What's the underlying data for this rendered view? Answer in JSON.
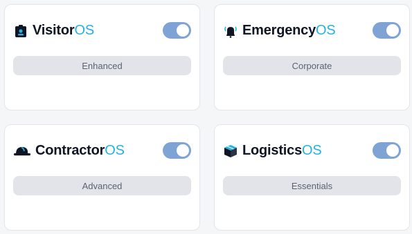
{
  "products": [
    {
      "name": "Visitor",
      "suffix": "OS",
      "icon": "visitor-badge-icon",
      "enabled": true,
      "tier": "Enhanced"
    },
    {
      "name": "Emergency",
      "suffix": "OS",
      "icon": "alarm-bell-icon",
      "enabled": true,
      "tier": "Corporate"
    },
    {
      "name": "Contractor",
      "suffix": "OS",
      "icon": "hard-hat-icon",
      "enabled": true,
      "tier": "Advanced"
    },
    {
      "name": "Logistics",
      "suffix": "OS",
      "icon": "package-box-icon",
      "enabled": true,
      "tier": "Essentials"
    }
  ],
  "colors": {
    "accent_os": "#22b4e0",
    "toggle_on": "#7ea3d4",
    "tier_bg": "#e2e4ea",
    "title": "#0f1524"
  }
}
